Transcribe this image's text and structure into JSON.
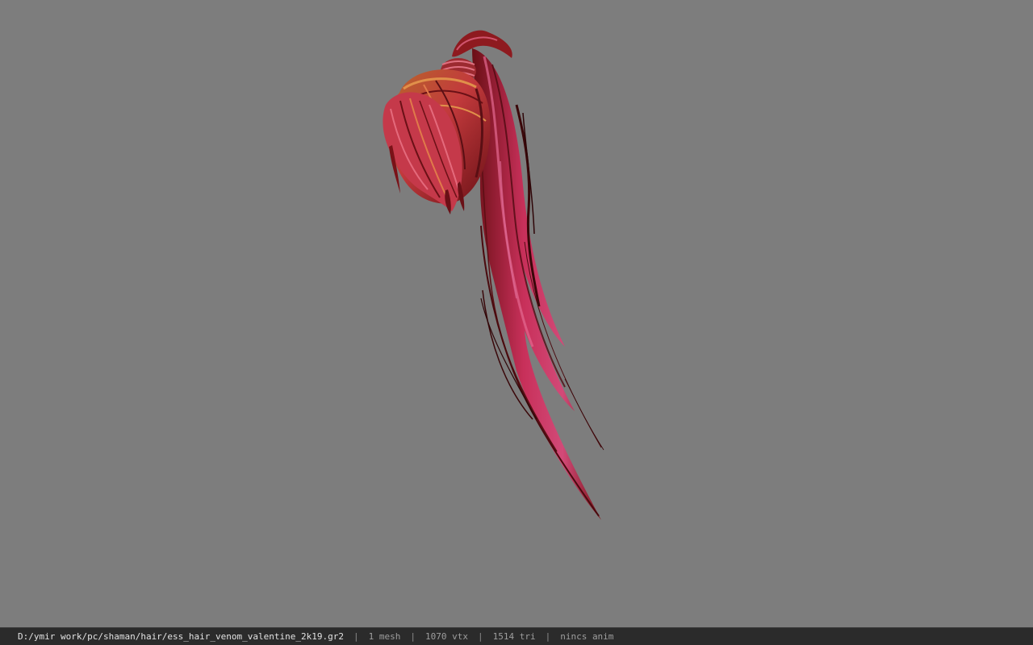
{
  "viewport": {
    "background": "#7d7d7d",
    "model_name": "ess_hair_venom_valentine_2k19",
    "model_colors": [
      "#8e1a1f",
      "#c23a3c",
      "#d0556e",
      "#b7682a",
      "#5a0f14"
    ]
  },
  "status_bar": {
    "file_path": "D:/ymir work/pc/shaman/hair/ess_hair_venom_valentine_2k19.gr2",
    "separator": "|",
    "mesh_count": "1 mesh",
    "vertex_count": "1070 vtx",
    "triangle_count": "1514 tri",
    "animation_status": "nincs anim"
  }
}
